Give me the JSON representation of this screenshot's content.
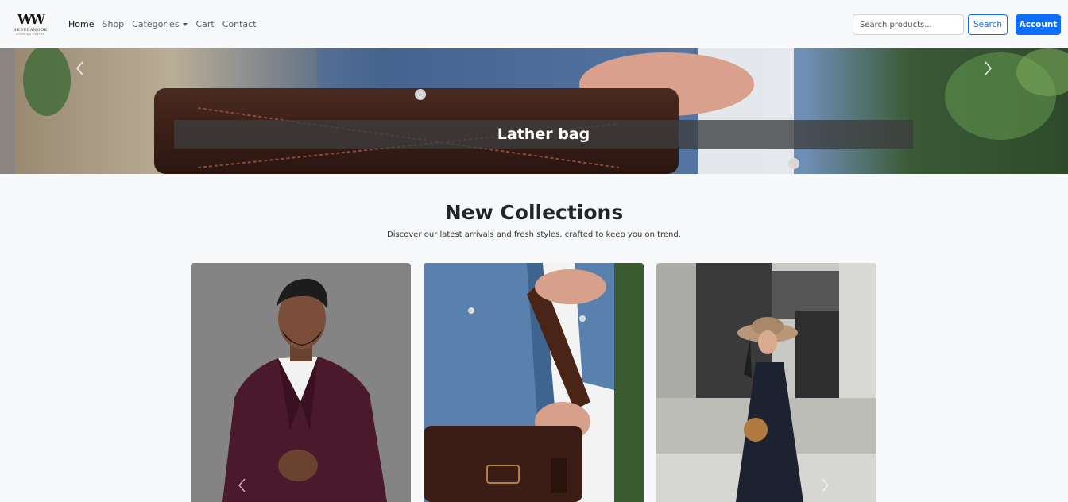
{
  "brand": {
    "mark": "W",
    "name": "NEBULANOOK",
    "tagline": "SHOPPING CENTER"
  },
  "nav": {
    "items": [
      {
        "label": "Home",
        "active": true
      },
      {
        "label": "Shop"
      },
      {
        "label": "Categories"
      },
      {
        "label": "Cart"
      },
      {
        "label": "Contact"
      }
    ]
  },
  "search": {
    "placeholder": "Search products...",
    "value": "",
    "button_label": "Search"
  },
  "account_label": "Account",
  "hero": {
    "caption": "Lather bag"
  },
  "collections": {
    "title": "New Collections",
    "subtitle": "Discover our latest arrivals and fresh styles, crafted to keep you on trend."
  },
  "icons": [
    "chevron-left-icon",
    "chevron-right-icon",
    "caret-down-icon"
  ],
  "colors": {
    "primary": "#0d6efd",
    "background": "#f8f9fa",
    "text": "#212529"
  }
}
